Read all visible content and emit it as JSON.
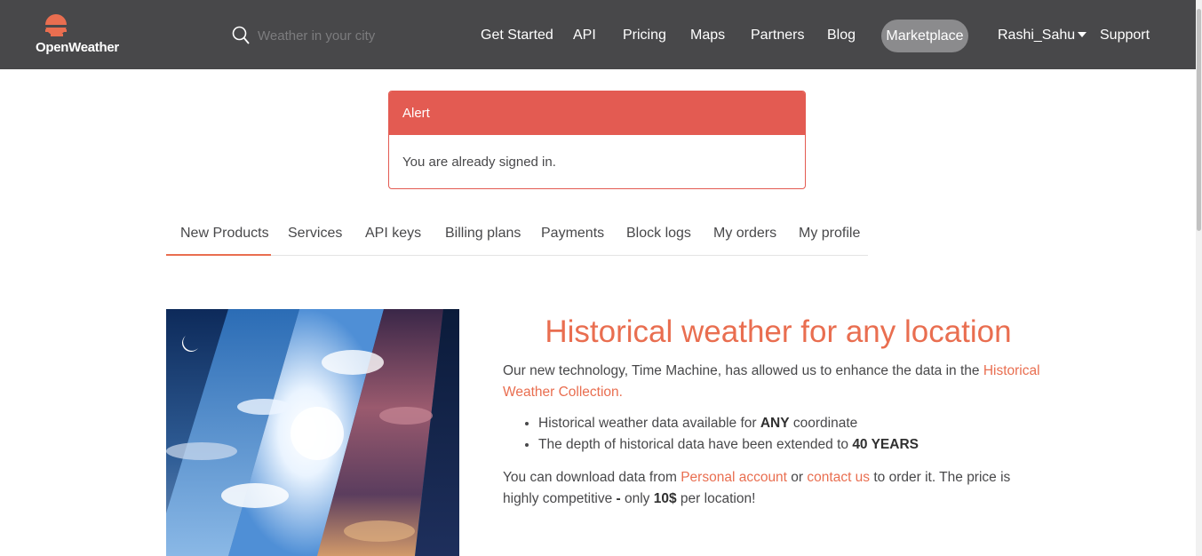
{
  "brand": {
    "name": "OpenWeather",
    "accent": "#e96e50",
    "navbar_bg": "#48484a",
    "alert_color": "#e35b52"
  },
  "search": {
    "placeholder": "Weather in your city"
  },
  "nav": {
    "get_started": "Get Started",
    "api": "API",
    "pricing": "Pricing",
    "maps": "Maps",
    "partners": "Partners",
    "blog": "Blog",
    "marketplace": "Marketplace",
    "user": "Rashi_Sahu",
    "support": "Support"
  },
  "alert": {
    "title": "Alert",
    "message": "You are already signed in."
  },
  "tabs": [
    {
      "label": "New Products",
      "active": true
    },
    {
      "label": "Services"
    },
    {
      "label": "API keys"
    },
    {
      "label": "Billing plans"
    },
    {
      "label": "Payments"
    },
    {
      "label": "Block logs"
    },
    {
      "label": "My orders"
    },
    {
      "label": "My profile"
    }
  ],
  "content": {
    "headline": "Historical weather for any location",
    "intro_text": "Our new technology, Time Machine, has allowed us to enhance the data in the ",
    "intro_link": "Historical Weather Collection",
    "intro_end": ".",
    "bullet1_pre": "Historical weather data available for ",
    "bullet1_bold": "ANY",
    "bullet1_post": " coordinate",
    "bullet2_pre": "The depth of historical data have been extended to ",
    "bullet2_bold": "40 YEARS",
    "download_pre": "You can download data from ",
    "personal_account_link": "Personal account",
    "download_or": " or ",
    "contact_link": "contact us",
    "download_post": " to order it. The price is highly competitive ",
    "dash": "-",
    "only": " only ",
    "price": "10$",
    "per_location": " per location!"
  },
  "icons": {
    "logo": "openweather-logo",
    "search": "search-icon",
    "dropdown": "caret-down-icon"
  }
}
